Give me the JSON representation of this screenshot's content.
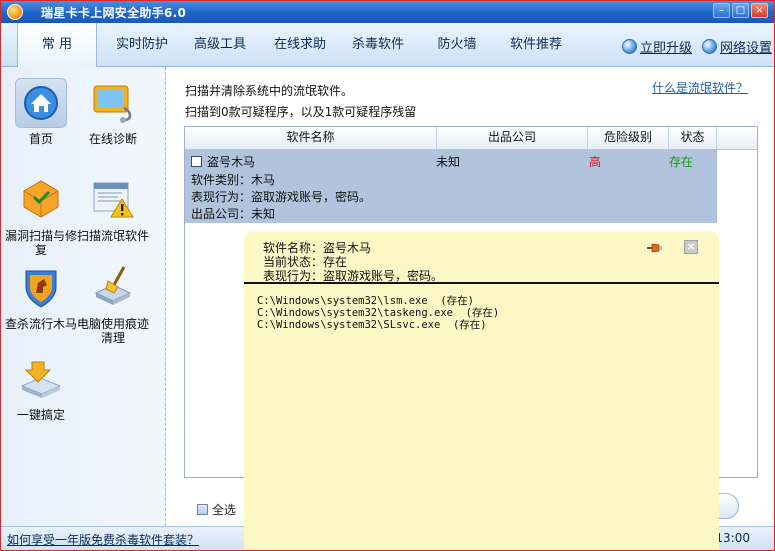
{
  "app": {
    "title": "瑞星卡卡上网安全助手6.0"
  },
  "tabs": [
    {
      "label": "常 用",
      "active": true
    },
    {
      "label": "实时防护"
    },
    {
      "label": "高级工具"
    },
    {
      "label": "在线求助"
    },
    {
      "label": "杀毒软件"
    },
    {
      "label": "防火墙"
    },
    {
      "label": "软件推荐"
    }
  ],
  "top_links": {
    "upgrade": "立即升级",
    "settings": "网络设置"
  },
  "sidebar": {
    "items": [
      {
        "label": "首页",
        "icon": "home-icon"
      },
      {
        "label": "在线诊断",
        "icon": "monitor-stethoscope-icon"
      },
      {
        "label": "漏洞扫描与修复",
        "icon": "shield-scan-icon"
      },
      {
        "label": "扫描流氓软件",
        "icon": "warning-window-icon"
      },
      {
        "label": "查杀流行木马",
        "icon": "shield-horse-icon"
      },
      {
        "label": "电脑使用痕迹清理",
        "icon": "broom-drive-icon"
      },
      {
        "label": "一键搞定",
        "icon": "one-click-icon"
      }
    ]
  },
  "main": {
    "desc_line1": "扫描并清除系统中的流氓软件。",
    "desc_line2": "扫描到0款可疑程序，以及1款可疑程序残留",
    "help_link": "什么是流氓软件？",
    "columns": [
      "软件名称",
      "出品公司",
      "危险级别",
      "状态"
    ],
    "row": {
      "name": "盗号木马",
      "maker": "未知",
      "level": "高",
      "status": "存在",
      "detail_type": "软件类别：木马",
      "detail_behavior": "表现行为：盗取游戏账号，密码。",
      "detail_maker": "出品公司：未知"
    },
    "select_all": "全选"
  },
  "popup": {
    "line1": "软件名称：盗号木马",
    "line2": "当前状态：存在",
    "line3": "表现行为：盗取游戏账号，密码。",
    "paths": [
      "C:\\Windows\\system32\\lsm.exe  (存在)",
      "C:\\Windows\\system32\\taskeng.exe  (存在)",
      "C:\\Windows\\system32\\SLsvc.exe  (存在)"
    ]
  },
  "statusbar": {
    "promo_link": "如何享受一年版免费杀毒软件套装？",
    "time": "13:00"
  },
  "colors": {
    "danger": "#e0111b",
    "ok": "#1a9b1a",
    "popup_bg": "#fcf8c6"
  }
}
